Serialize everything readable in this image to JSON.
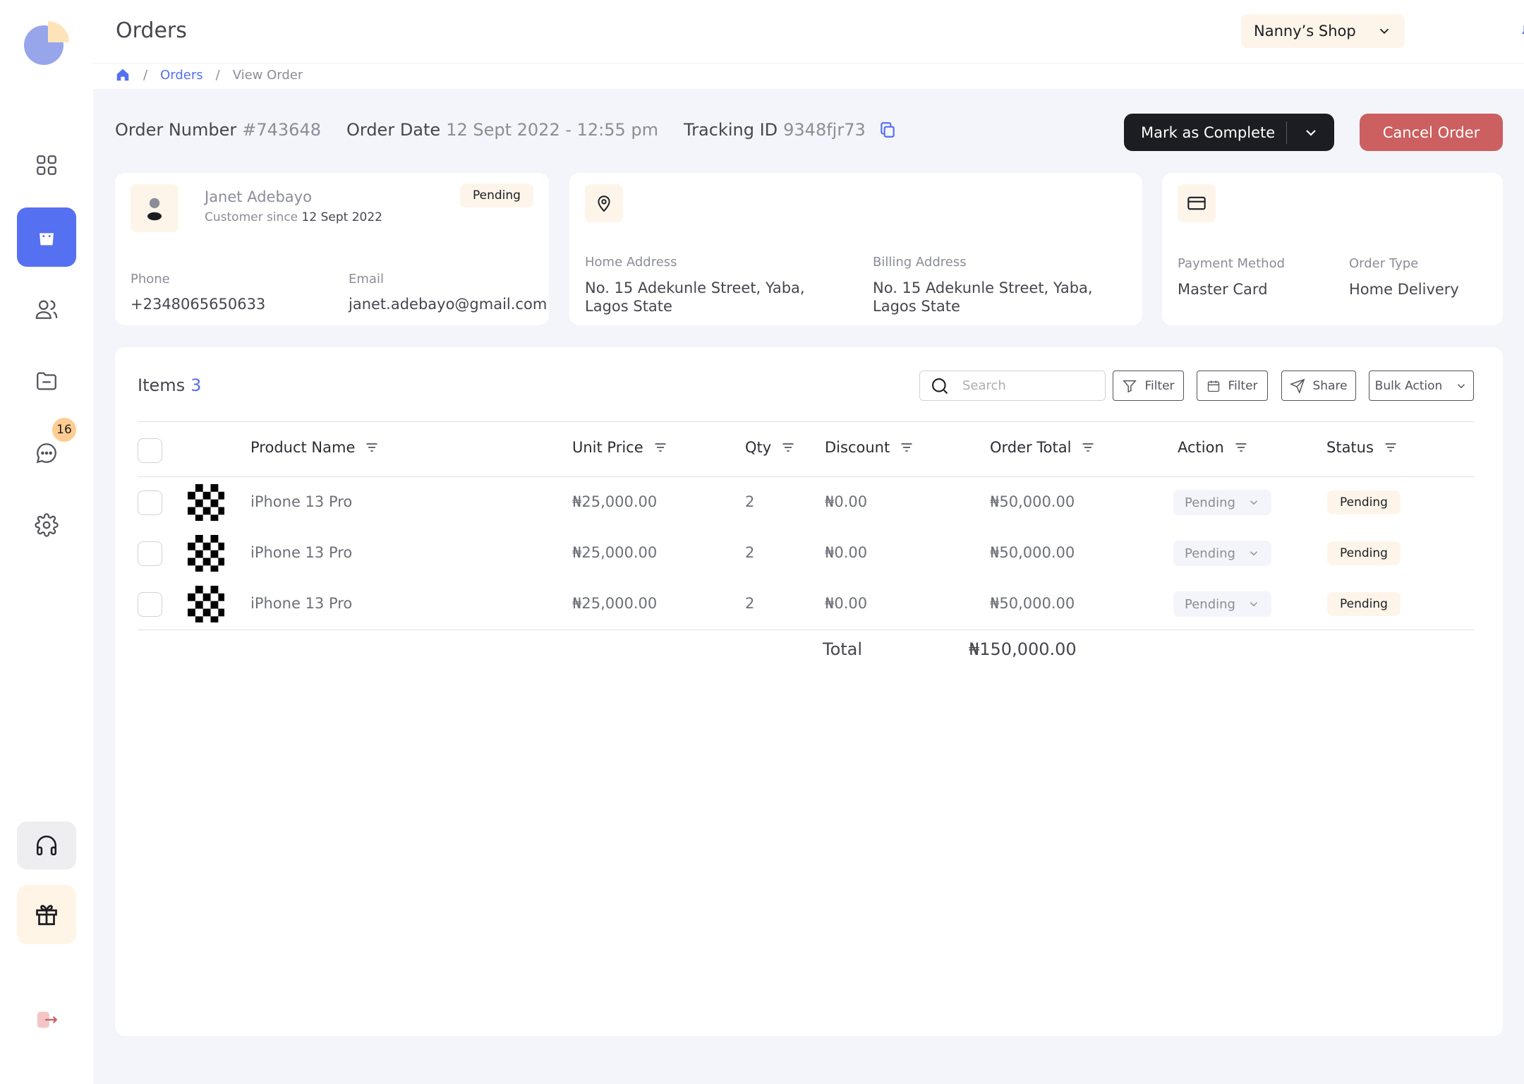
{
  "header": {
    "title": "Orders",
    "shop_name": "Nanny’s Shop"
  },
  "breadcrumb": {
    "orders": "Orders",
    "current": "View Order",
    "separator": "/"
  },
  "order": {
    "number_label": "Order Number",
    "number": "#743648",
    "date_label": "Order Date",
    "date": "12 Sept 2022 - 12:55 pm",
    "tracking_label": "Tracking ID",
    "tracking": "9348fjr73"
  },
  "actions": {
    "mark_complete": "Mark as Complete",
    "cancel": "Cancel Order"
  },
  "customer": {
    "name": "Janet Adebayo",
    "since_label": "Customer since",
    "since_date": "12 Sept 2022",
    "status": "Pending",
    "phone_label": "Phone",
    "phone": "+2348065650633",
    "email_label": "Email",
    "email": "janet.adebayo@gmail.com"
  },
  "address": {
    "home_label": "Home Address",
    "home_line1": "No. 15 Adekunle Street, Yaba,",
    "home_line2": "Lagos State",
    "billing_label": "Billing Address",
    "billing_line1": "No. 15 Adekunle Street, Yaba,",
    "billing_line2": "Lagos State"
  },
  "payment": {
    "method_label": "Payment Method",
    "method": "Master Card",
    "type_label": "Order Type",
    "type": "Home Delivery"
  },
  "items": {
    "title": "Items",
    "count": "3",
    "search_placeholder": "Search",
    "filter_label": "Filter",
    "date_filter_label": "Filter",
    "share_label": "Share",
    "bulk_label": "Bulk Action",
    "columns": [
      "Product Name",
      "Unit Price",
      "Qty",
      "Discount",
      "Order Total",
      "Action",
      "Status"
    ],
    "rows": [
      {
        "product": "iPhone 13 Pro",
        "unit_price": "₦25,000.00",
        "qty": "2",
        "discount": "₦0.00",
        "total": "₦50,000.00",
        "action": "Pending",
        "status": "Pending"
      },
      {
        "product": "iPhone 13 Pro",
        "unit_price": "₦25,000.00",
        "qty": "2",
        "discount": "₦0.00",
        "total": "₦50,000.00",
        "action": "Pending",
        "status": "Pending"
      },
      {
        "product": "iPhone 13 Pro",
        "unit_price": "₦25,000.00",
        "qty": "2",
        "discount": "₦0.00",
        "total": "₦50,000.00",
        "action": "Pending",
        "status": "Pending"
      }
    ],
    "total_label": "Total",
    "total_value": "₦150,000.00"
  },
  "sidebar": {
    "chat_badge": "16",
    "items": [
      {
        "icon": "dashboard-grid-icon"
      },
      {
        "icon": "shopping-bag-icon",
        "active": true
      },
      {
        "icon": "customers-icon"
      },
      {
        "icon": "folder-icon"
      },
      {
        "icon": "chat-icon"
      },
      {
        "icon": "settings-gear-icon"
      }
    ]
  },
  "colors": {
    "accent": "#5570f1",
    "dark": "#1c1d22",
    "danger": "#cc5f5f",
    "pending_bg": "#fef5ea",
    "page_bg": "#f4f5fa"
  }
}
